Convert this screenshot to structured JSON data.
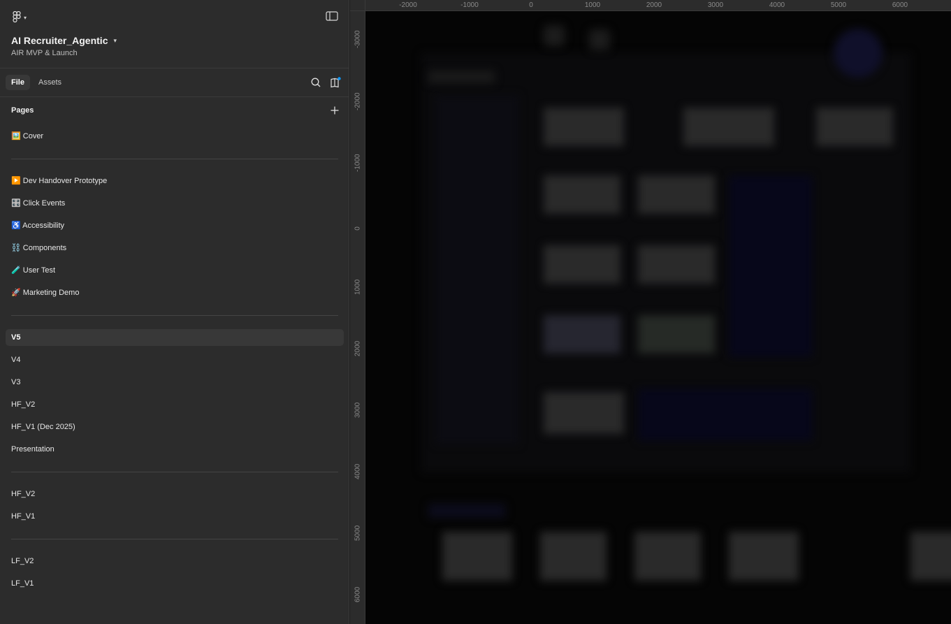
{
  "file": {
    "title": "AI Recruiter_Agentic",
    "project": "AIR MVP & Launch"
  },
  "tabs": {
    "file": "File",
    "assets": "Assets"
  },
  "pages": {
    "header": "Pages",
    "items": [
      {
        "label": "🖼️ Cover"
      },
      {
        "label": "▶️ Dev Handover Prototype"
      },
      {
        "label": "🎛️ Click Events"
      },
      {
        "label": "♿ Accessibility"
      },
      {
        "label": "⛓️ Components"
      },
      {
        "label": "🧪 User Test"
      },
      {
        "label": "🚀 Marketing Demo"
      },
      {
        "label": "V5",
        "selected": true
      },
      {
        "label": "V4"
      },
      {
        "label": "V3"
      },
      {
        "label": "HF_V2"
      },
      {
        "label": "HF_V1 (Dec 2025)"
      },
      {
        "label": "Presentation"
      },
      {
        "label": "HF_V2"
      },
      {
        "label": "HF_V1"
      },
      {
        "label": "LF_V2"
      },
      {
        "label": "LF_V1"
      }
    ]
  },
  "rulers": {
    "horizontal": [
      "-2000",
      "-1000",
      "0",
      "1000",
      "2000",
      "3000",
      "4000",
      "5000",
      "6000"
    ],
    "vertical": [
      "-3000",
      "-2000",
      "-1000",
      "0",
      "1000",
      "2000",
      "3000",
      "4000",
      "5000",
      "6000"
    ]
  },
  "colors": {
    "sidebar_bg": "#2c2c2c",
    "canvas_bg": "#050505",
    "selected_bg": "#383838",
    "notification_dot": "#0d99ff"
  }
}
